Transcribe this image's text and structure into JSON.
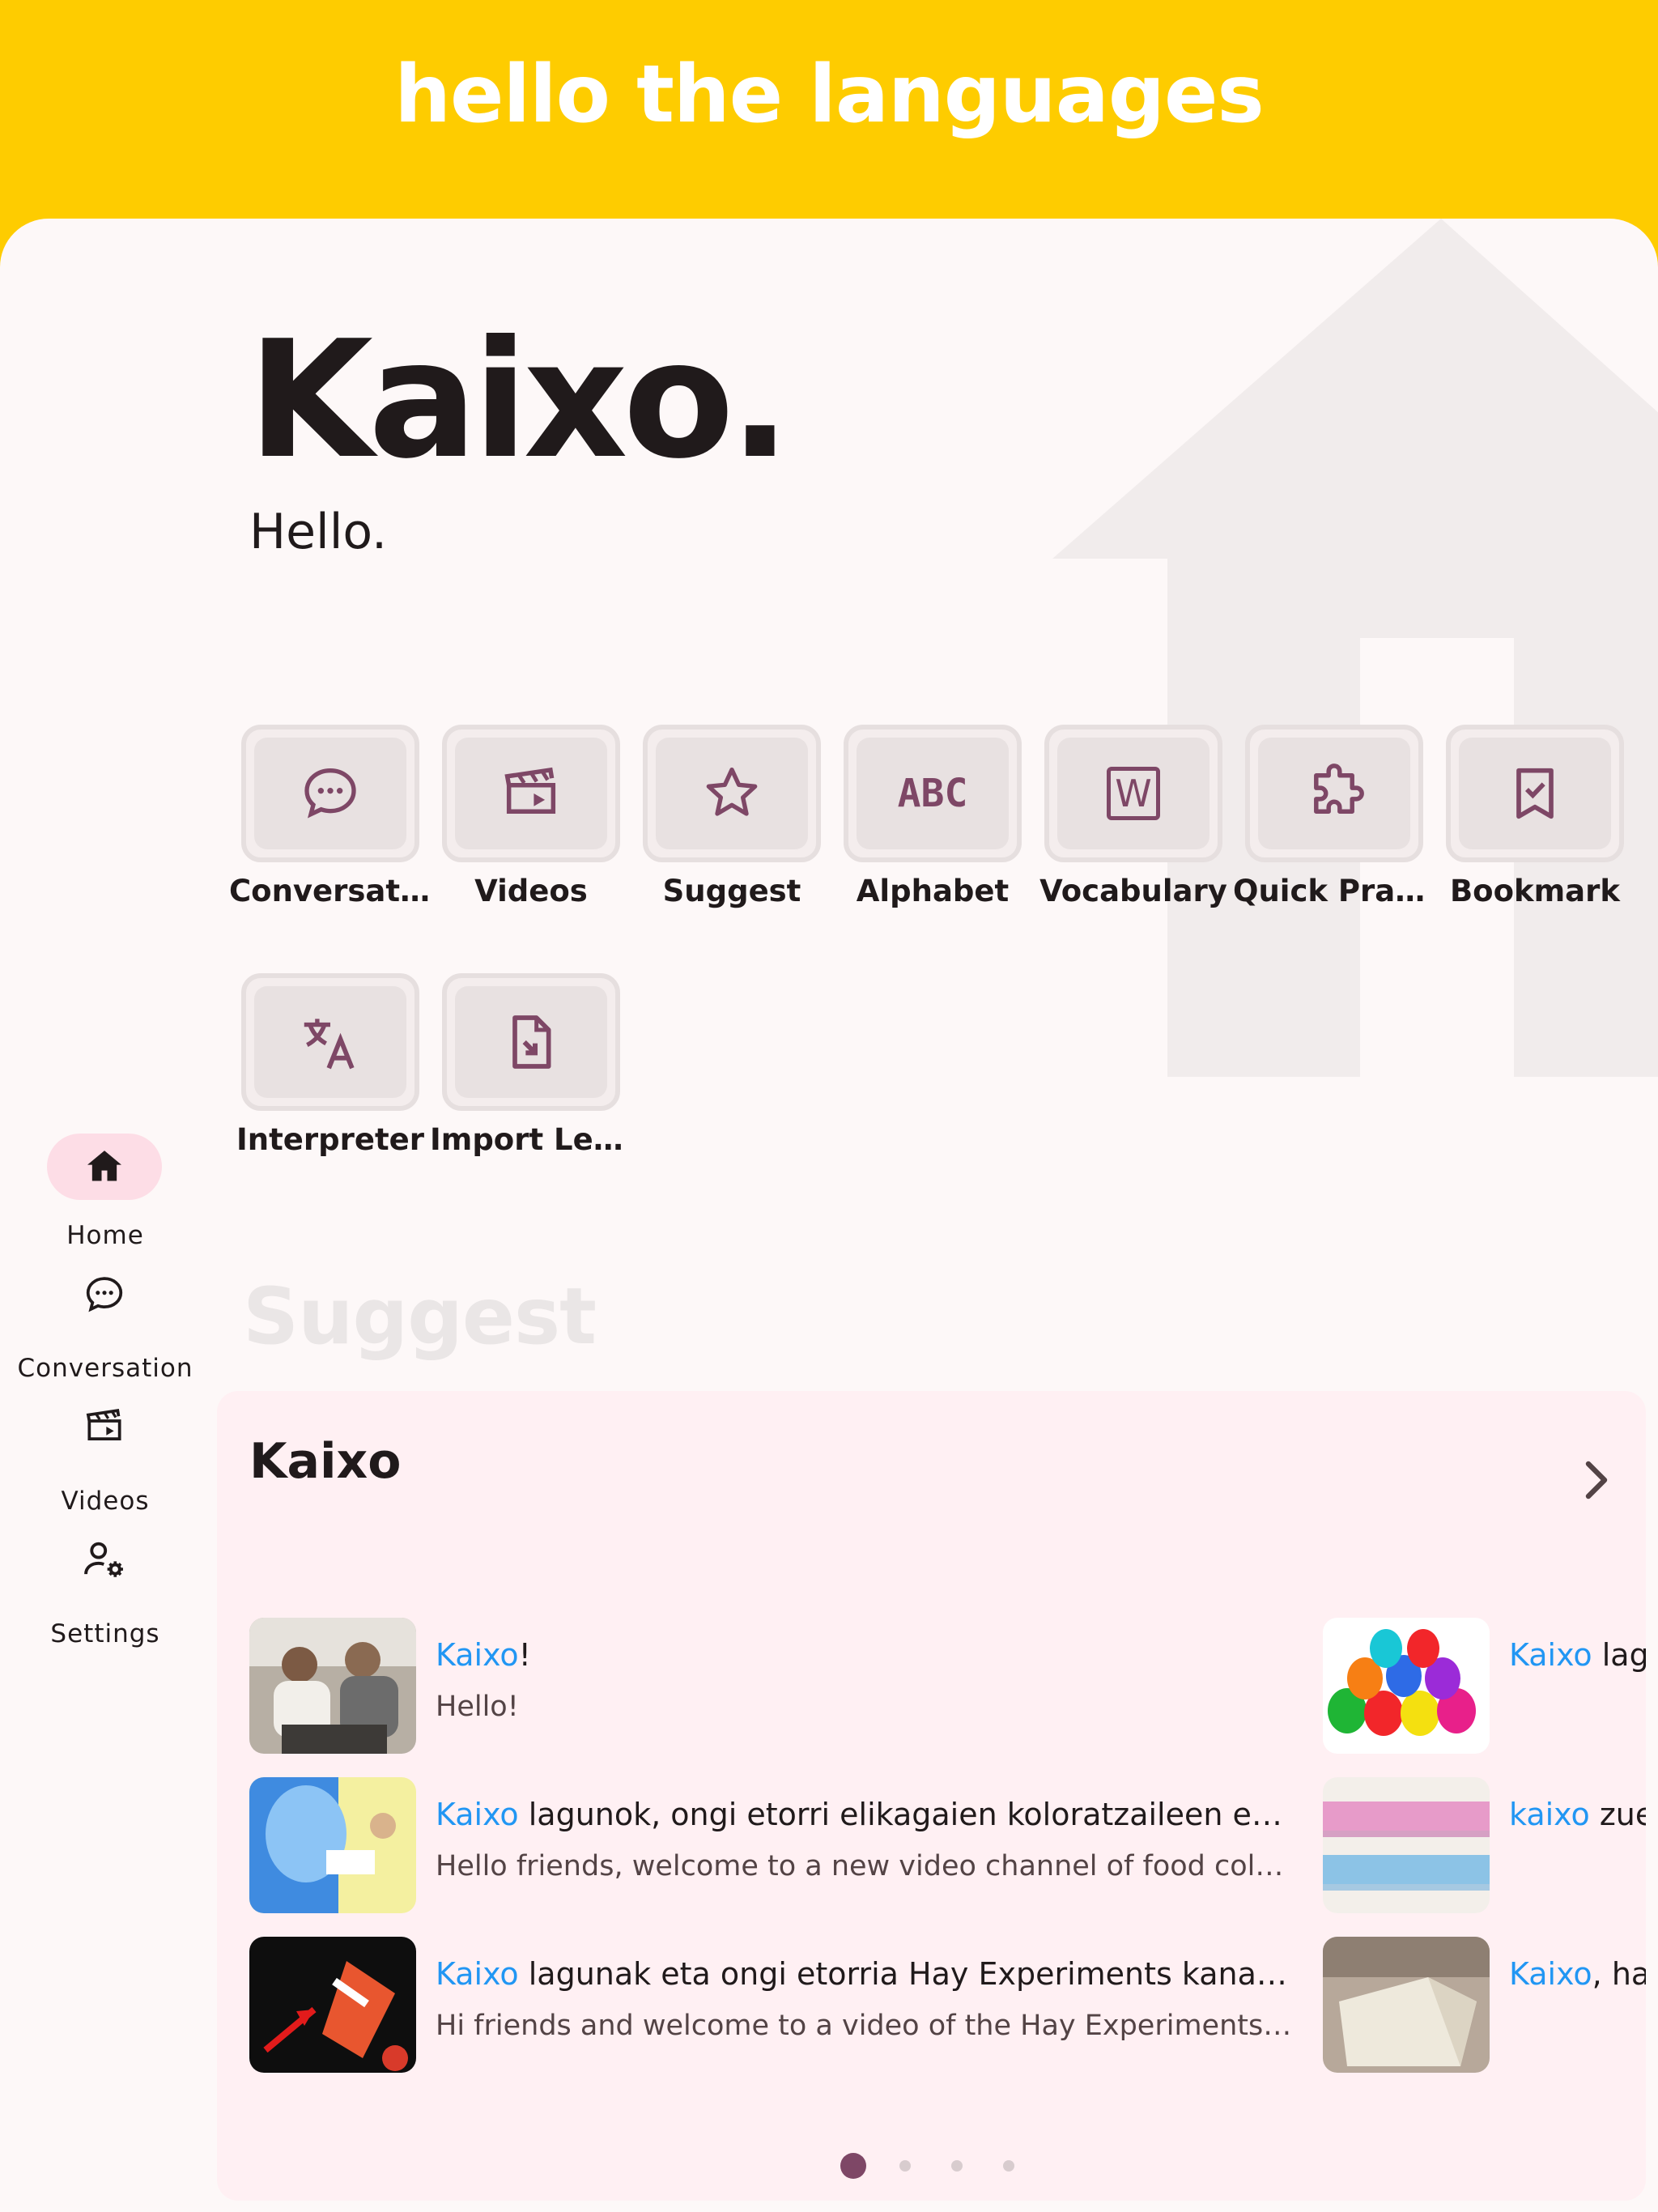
{
  "app": {
    "title": "hello the languages"
  },
  "hero": {
    "word": "Kaixo.",
    "translation": "Hello."
  },
  "tiles": [
    {
      "label": "Conversati...",
      "icon": "chat-bubble-icon"
    },
    {
      "label": "Videos",
      "icon": "video-clapper-icon"
    },
    {
      "label": "Suggest",
      "icon": "star-icon"
    },
    {
      "label": "Alphabet",
      "icon": "abc-icon",
      "glyph": "ABC"
    },
    {
      "label": "Vocabulary",
      "icon": "word-document-icon",
      "glyph": "W"
    },
    {
      "label": "Quick Prac...",
      "icon": "puzzle-icon"
    },
    {
      "label": "Bookmark",
      "icon": "bookmark-check-icon"
    },
    {
      "label": "Interpreter",
      "icon": "translate-icon"
    },
    {
      "label": "Import Les...",
      "icon": "file-import-icon"
    }
  ],
  "nav": [
    {
      "label": "Home",
      "icon": "home-icon",
      "active": true
    },
    {
      "label": "Conversation",
      "icon": "chat-bubble-icon",
      "active": false
    },
    {
      "label": "Videos",
      "icon": "video-clapper-icon",
      "active": false
    },
    {
      "label": "Settings",
      "icon": "user-settings-icon",
      "active": false
    }
  ],
  "suggest": {
    "heading": "Suggest",
    "card_title": "Kaixo",
    "items": [
      {
        "highlight": "Kaixo",
        "title_rest": "!",
        "subtitle": "Hello!"
      },
      {
        "highlight": "Kaixo",
        "title_rest": " lagunok, ongi etorri elikagaien koloratzaileen es...",
        "subtitle": "Hello friends, welcome to a new video channel of food colori..."
      },
      {
        "highlight": "Kaixo",
        "title_rest": " lagunak eta ongi etorria Hay Experiments kanale...",
        "subtitle": "Hi friends and welcome to a video of the Hay Experiments C..."
      },
      {
        "highlight": "Kaixo",
        "title_rest": " lagu",
        "subtitle": ""
      },
      {
        "highlight": "kaixo",
        "title_rest": " zuel",
        "subtitle": ""
      },
      {
        "highlight": "Kaixo",
        "title_rest": ", hau",
        "subtitle": ""
      }
    ],
    "page_count": 4,
    "active_page": 0
  },
  "colors": {
    "brand_yellow": "#FECC00",
    "accent": "#7E4766",
    "highlight_blue": "#2196F3",
    "pill": "#FDDDE6"
  }
}
